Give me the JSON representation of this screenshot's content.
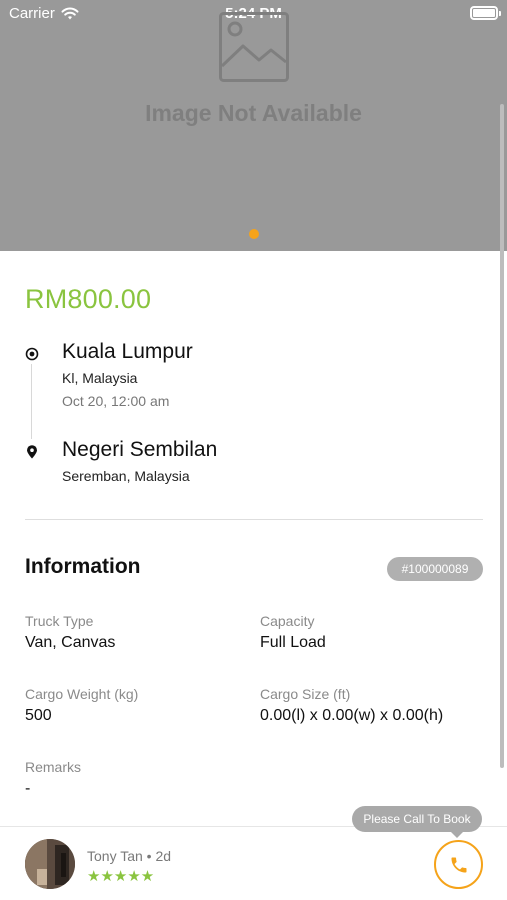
{
  "status_bar": {
    "carrier": "Carrier",
    "time": "5:24 PM",
    "icons": [
      "wifi-icon",
      "battery-icon"
    ]
  },
  "hero": {
    "placeholder_text": "Image Not Available",
    "page_count": 1,
    "active_page": 1,
    "dot_color": "#f5a31a",
    "background": "#999999"
  },
  "price": "RM800.00",
  "route": {
    "origin": {
      "title": "Kuala Lumpur",
      "subtitle": "Kl, Malaysia",
      "datetime": "Oct 20, 12:00 am",
      "icon": "origin-target-icon"
    },
    "destination": {
      "title": "Negeri Sembilan",
      "subtitle": "Seremban, Malaysia",
      "icon": "location-pin-icon"
    }
  },
  "information": {
    "title": "Information",
    "id_badge": "#100000089",
    "fields": {
      "truck_type": {
        "label": "Truck Type",
        "value": "Van, Canvas"
      },
      "capacity": {
        "label": "Capacity",
        "value": "Full Load"
      },
      "cargo_weight": {
        "label": "Cargo Weight (kg)",
        "value": "500"
      },
      "cargo_size": {
        "label": "Cargo Size (ft)",
        "value": "0.00(l) x 0.00(w) x 0.00(h)"
      },
      "remarks": {
        "label": "Remarks",
        "value": "-"
      }
    }
  },
  "footer": {
    "poster_name": "Tony Tan • 2d",
    "rating_stars": "★★★★★",
    "rating": 5,
    "tooltip": "Please Call To Book",
    "call_icon": "phone-icon"
  },
  "colors": {
    "accent_green": "#8ac43f",
    "accent_orange": "#f5a31a"
  }
}
